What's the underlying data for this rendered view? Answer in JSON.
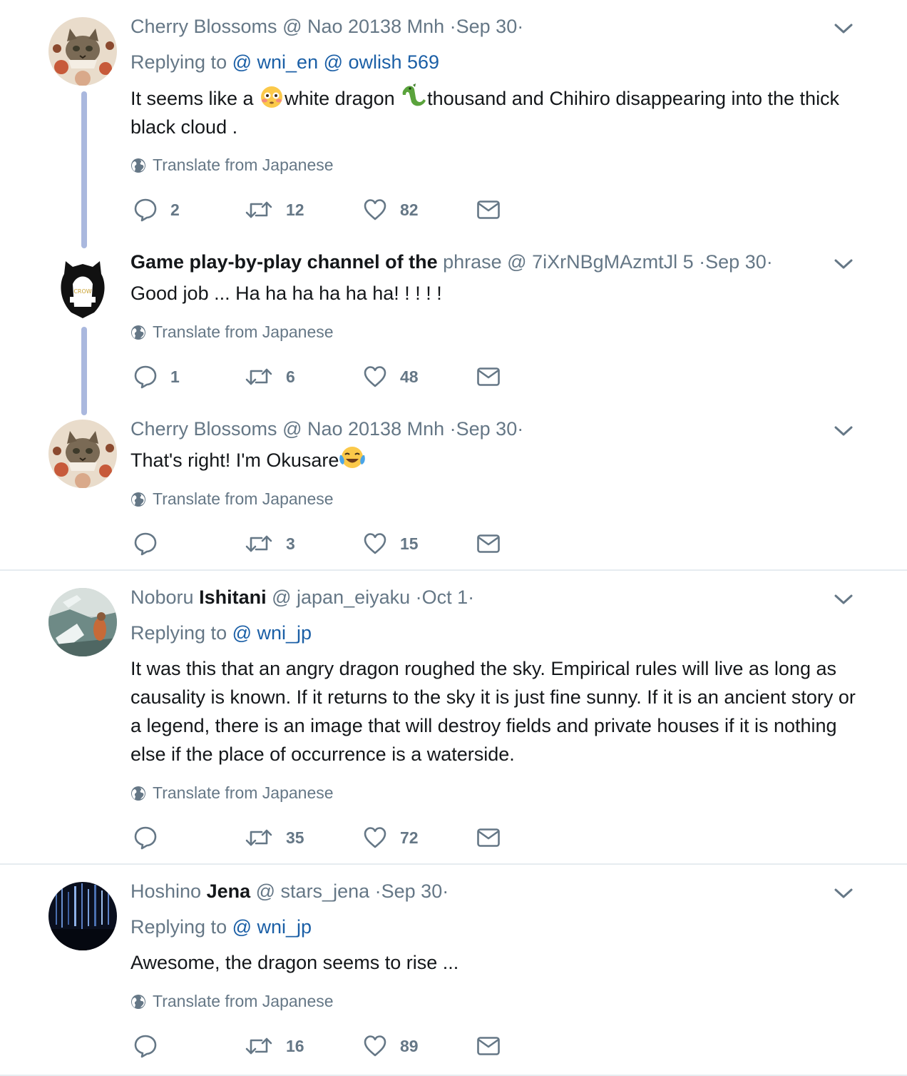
{
  "tweets": [
    {
      "name_pre": "Cherry Blossoms",
      "handle": "@ Nao 20138 Mnh",
      "date": "·Sep 30·",
      "replying_prefix": "Replying to",
      "replying_to": "@ wni_en @ owlish 569",
      "text_1": "It seems like a ",
      "text_2": "white dragon ",
      "text_3": "thousand and Chihiro disappearing into the thick black cloud .",
      "translate": "Translate from Japanese",
      "replies": "2",
      "retweets": "12",
      "likes": "82"
    },
    {
      "name_bold": "Game play-by-play channel of the",
      "handle": "phrase @ 7iXrNBgMAzmtJl 5",
      "date": "·Sep 30·",
      "text": "Good job ... Ha ha ha ha ha ha! ! ! ! !",
      "translate": "Translate from Japanese",
      "replies": "1",
      "retweets": "6",
      "likes": "48",
      "avatar_text": "CROW"
    },
    {
      "name_pre": "Cherry Blossoms",
      "handle": "@ Nao 20138 Mnh",
      "date": "·Sep 30·",
      "text": "That's right! I'm Okusare",
      "translate": "Translate from Japanese",
      "replies": "",
      "retweets": "3",
      "likes": "15"
    },
    {
      "name_pre": "Noboru",
      "name_bold": "Ishitani",
      "handle": "@ japan_eiyaku",
      "date": "·Oct 1·",
      "replying_prefix": "Replying to",
      "replying_to": "@ wni_jp",
      "text": "It was this that an angry dragon roughed the sky. Empirical rules will live as long as causality is known. If it returns to the sky it is just fine sunny. If it is an ancient story or a legend, there is an image that will destroy fields and private houses if it is nothing else if the place of occurrence is a waterside.",
      "translate": "Translate from Japanese",
      "replies": "",
      "retweets": "35",
      "likes": "72"
    },
    {
      "name_pre": "Hoshino",
      "name_bold": "Jena",
      "handle": "@ stars_jena",
      "date": "·Sep 30·",
      "replying_prefix": "Replying to",
      "replying_to": "@ wni_jp",
      "text": "Awesome, the dragon seems to rise ...",
      "translate": "Translate from Japanese",
      "replies": "",
      "retweets": "16",
      "likes": "89"
    }
  ],
  "icons": [
    "reply-icon",
    "retweet-icon",
    "like-icon",
    "message-icon",
    "globe-icon",
    "chevron-down-icon"
  ],
  "colors": {
    "link": "#1b5fa6",
    "muted": "#657786",
    "thread": "#aab8de",
    "divider": "#e6ecf0"
  }
}
